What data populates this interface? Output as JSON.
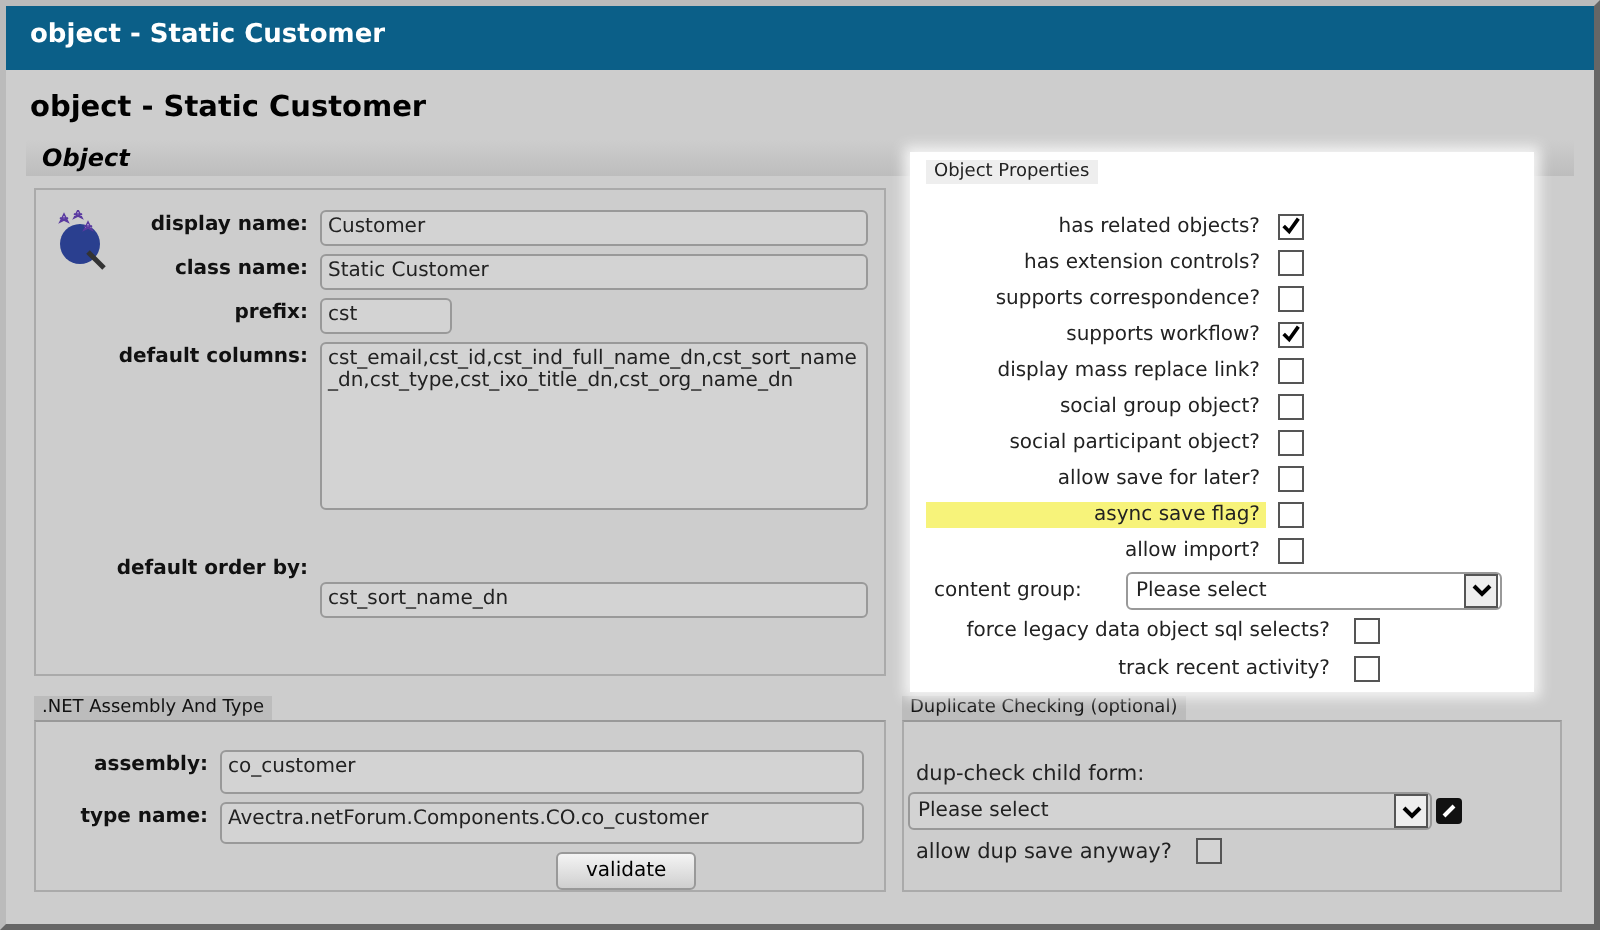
{
  "window": {
    "title": "object - Static Customer"
  },
  "page_heading": "object - Static Customer",
  "object_section": {
    "title": "Object",
    "fields": [
      {
        "label": "display name:",
        "value": "Customer",
        "kind": "text"
      },
      {
        "label": "class name:",
        "value": "Static Customer",
        "kind": "text"
      },
      {
        "label": "prefix:",
        "value": "cst",
        "kind": "short"
      },
      {
        "label": "default columns:",
        "value": "cst_email,cst_id,cst_ind_full_name_dn,cst_sort_name_dn,cst_type,cst_ixo_title_dn,cst_org_name_dn",
        "kind": "area"
      },
      {
        "label": "default order by:",
        "value": "cst_sort_name_dn",
        "kind": "text"
      }
    ]
  },
  "object_properties": {
    "title": "Object Properties",
    "items": [
      {
        "kind": "checkbox",
        "label": "has related objects?",
        "checked": true,
        "highlighted": false
      },
      {
        "kind": "checkbox",
        "label": "has extension controls?",
        "checked": false,
        "highlighted": false
      },
      {
        "kind": "checkbox",
        "label": "supports correspondence?",
        "checked": false,
        "highlighted": false
      },
      {
        "kind": "checkbox",
        "label": "supports workflow?",
        "checked": true,
        "highlighted": false
      },
      {
        "kind": "checkbox",
        "label": "display mass replace link?",
        "checked": false,
        "highlighted": false
      },
      {
        "kind": "checkbox",
        "label": "social group object?",
        "checked": false,
        "highlighted": false
      },
      {
        "kind": "checkbox",
        "label": "social participant object?",
        "checked": false,
        "highlighted": false
      },
      {
        "kind": "checkbox",
        "label": "allow save for later?",
        "checked": false,
        "highlighted": false
      },
      {
        "kind": "checkbox",
        "label": "async save flag?",
        "checked": false,
        "highlighted": true
      },
      {
        "kind": "checkbox",
        "label": "allow import?",
        "checked": false,
        "highlighted": false
      },
      {
        "kind": "select",
        "label": "content group:",
        "value": "Please select"
      },
      {
        "kind": "wide-checkbox",
        "label": "force legacy data object sql selects?",
        "checked": false
      },
      {
        "kind": "wide-checkbox",
        "label": "track recent activity?",
        "checked": false
      }
    ]
  },
  "assembly_section": {
    "title": ".NET Assembly And Type",
    "fields": [
      {
        "label": "assembly:",
        "value": "co_customer"
      },
      {
        "label": "type name:",
        "value": "Avectra.netForum.Components.CO.co_customer"
      }
    ],
    "button": "validate"
  },
  "duplicate_section": {
    "title": "Duplicate Checking (optional)",
    "form_label": "dup-check child form:",
    "form_value": "Please select",
    "allow_label": "allow dup save anyway?",
    "allow_checked": false
  }
}
